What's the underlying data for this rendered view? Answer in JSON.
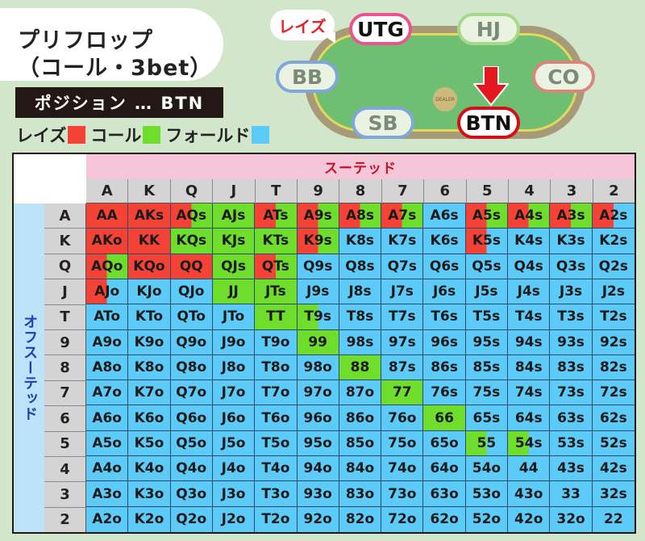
{
  "title": {
    "line1": "プリフロップ",
    "line2": "（コール・3bet）"
  },
  "position_label": "ポジション … BTN",
  "legend": [
    {
      "label": "レイズ",
      "color": "#f44336",
      "action": "raise"
    },
    {
      "label": "コール",
      "color": "#6fdd2c",
      "action": "call"
    },
    {
      "label": "フォールド",
      "color": "#5dcbf8",
      "action": "fold"
    }
  ],
  "table_diagram": {
    "bubble_text": "レイズ",
    "dealer_text": "DEALER",
    "seats": [
      {
        "id": "UTG",
        "label": "UTG",
        "border": "#e9548e",
        "active": true
      },
      {
        "id": "HJ",
        "label": "HJ",
        "border": "#a6d98a",
        "active": false
      },
      {
        "id": "CO",
        "label": "CO",
        "border": "#d9857a",
        "active": false
      },
      {
        "id": "BTN",
        "label": "BTN",
        "border": "#d40f1a",
        "active": true
      },
      {
        "id": "SB",
        "label": "SB",
        "border": "#7ea7dc",
        "active": false
      },
      {
        "id": "BB",
        "label": "BB",
        "border": "#7ea7dc",
        "active": false
      }
    ],
    "hero": "BTN",
    "raiser": "UTG"
  },
  "grid": {
    "suited_header": "スーテッド",
    "offsuit_header": "オフスーテッド",
    "ranks": [
      "A",
      "K",
      "Q",
      "J",
      "T",
      "9",
      "8",
      "7",
      "6",
      "5",
      "4",
      "3",
      "2"
    ],
    "colors": {
      "R": "#f44336",
      "G": "#6fdd2c",
      "B": "#5dcbf8"
    },
    "rows": [
      [
        [
          "AA",
          "R"
        ],
        [
          "AKs",
          "R"
        ],
        [
          "AQs",
          "R/G"
        ],
        [
          "AJs",
          "G"
        ],
        [
          "ATs",
          "R/G"
        ],
        [
          "A9s",
          "R/G"
        ],
        [
          "A8s",
          "R/G"
        ],
        [
          "A7s",
          "R/G"
        ],
        [
          "A6s",
          "B"
        ],
        [
          "A5s",
          "R/G"
        ],
        [
          "A4s",
          "R/G"
        ],
        [
          "A3s",
          "R/G"
        ],
        [
          "A2s",
          "R/B"
        ]
      ],
      [
        [
          "AKo",
          "R"
        ],
        [
          "KK",
          "R"
        ],
        [
          "KQs",
          "G"
        ],
        [
          "KJs",
          "G"
        ],
        [
          "KTs",
          "G"
        ],
        [
          "K9s",
          "R/G"
        ],
        [
          "K8s",
          "B"
        ],
        [
          "K7s",
          "B"
        ],
        [
          "K6s",
          "B"
        ],
        [
          "K5s",
          "R/B"
        ],
        [
          "K4s",
          "B"
        ],
        [
          "K3s",
          "B"
        ],
        [
          "K2s",
          "B"
        ]
      ],
      [
        [
          "AQo",
          "R/G"
        ],
        [
          "KQo",
          "R"
        ],
        [
          "QQ",
          "R"
        ],
        [
          "QJs",
          "G"
        ],
        [
          "QTs",
          "R/G"
        ],
        [
          "Q9s",
          "B"
        ],
        [
          "Q8s",
          "B"
        ],
        [
          "Q7s",
          "B"
        ],
        [
          "Q6s",
          "B"
        ],
        [
          "Q5s",
          "B"
        ],
        [
          "Q4s",
          "B"
        ],
        [
          "Q3s",
          "B"
        ],
        [
          "Q2s",
          "B"
        ]
      ],
      [
        [
          "AJo",
          "R/B"
        ],
        [
          "KJo",
          "B"
        ],
        [
          "QJo",
          "B"
        ],
        [
          "JJ",
          "G"
        ],
        [
          "JTs",
          "G"
        ],
        [
          "J9s",
          "B"
        ],
        [
          "J8s",
          "B"
        ],
        [
          "J7s",
          "B"
        ],
        [
          "J6s",
          "B"
        ],
        [
          "J5s",
          "B"
        ],
        [
          "J4s",
          "B"
        ],
        [
          "J3s",
          "B"
        ],
        [
          "J2s",
          "B"
        ]
      ],
      [
        [
          "ATo",
          "B"
        ],
        [
          "KTo",
          "B"
        ],
        [
          "QTo",
          "B"
        ],
        [
          "JTo",
          "B"
        ],
        [
          "TT",
          "G"
        ],
        [
          "T9s",
          "G/B"
        ],
        [
          "T8s",
          "B"
        ],
        [
          "T7s",
          "B"
        ],
        [
          "T6s",
          "B"
        ],
        [
          "T5s",
          "B"
        ],
        [
          "T4s",
          "B"
        ],
        [
          "T3s",
          "B"
        ],
        [
          "T2s",
          "B"
        ]
      ],
      [
        [
          "A9o",
          "B"
        ],
        [
          "K9o",
          "B"
        ],
        [
          "Q9o",
          "B"
        ],
        [
          "J9o",
          "B"
        ],
        [
          "T9o",
          "B"
        ],
        [
          "99",
          "G"
        ],
        [
          "98s",
          "B"
        ],
        [
          "97s",
          "B"
        ],
        [
          "96s",
          "B"
        ],
        [
          "95s",
          "B"
        ],
        [
          "94s",
          "B"
        ],
        [
          "93s",
          "B"
        ],
        [
          "92s",
          "B"
        ]
      ],
      [
        [
          "A8o",
          "B"
        ],
        [
          "K8o",
          "B"
        ],
        [
          "Q8o",
          "B"
        ],
        [
          "J8o",
          "B"
        ],
        [
          "T8o",
          "B"
        ],
        [
          "98o",
          "B"
        ],
        [
          "88",
          "G"
        ],
        [
          "87s",
          "B"
        ],
        [
          "86s",
          "B"
        ],
        [
          "85s",
          "B"
        ],
        [
          "84s",
          "B"
        ],
        [
          "83s",
          "B"
        ],
        [
          "82s",
          "B"
        ]
      ],
      [
        [
          "A7o",
          "B"
        ],
        [
          "K7o",
          "B"
        ],
        [
          "Q7o",
          "B"
        ],
        [
          "J7o",
          "B"
        ],
        [
          "T7o",
          "B"
        ],
        [
          "97o",
          "B"
        ],
        [
          "87o",
          "B"
        ],
        [
          "77",
          "G"
        ],
        [
          "76s",
          "B"
        ],
        [
          "75s",
          "B"
        ],
        [
          "74s",
          "B"
        ],
        [
          "73s",
          "B"
        ],
        [
          "72s",
          "B"
        ]
      ],
      [
        [
          "A6o",
          "B"
        ],
        [
          "K6o",
          "B"
        ],
        [
          "Q6o",
          "B"
        ],
        [
          "J6o",
          "B"
        ],
        [
          "T6o",
          "B"
        ],
        [
          "96o",
          "B"
        ],
        [
          "86o",
          "B"
        ],
        [
          "76o",
          "B"
        ],
        [
          "66",
          "G"
        ],
        [
          "65s",
          "B"
        ],
        [
          "64s",
          "B"
        ],
        [
          "63s",
          "B"
        ],
        [
          "62s",
          "B"
        ]
      ],
      [
        [
          "A5o",
          "B"
        ],
        [
          "K5o",
          "B"
        ],
        [
          "Q5o",
          "B"
        ],
        [
          "J5o",
          "B"
        ],
        [
          "T5o",
          "B"
        ],
        [
          "95o",
          "B"
        ],
        [
          "85o",
          "B"
        ],
        [
          "75o",
          "B"
        ],
        [
          "65o",
          "B"
        ],
        [
          "55",
          "G/B"
        ],
        [
          "54s",
          "G/B"
        ],
        [
          "53s",
          "B"
        ],
        [
          "52s",
          "B"
        ]
      ],
      [
        [
          "A4o",
          "B"
        ],
        [
          "K4o",
          "B"
        ],
        [
          "Q4o",
          "B"
        ],
        [
          "J4o",
          "B"
        ],
        [
          "T4o",
          "B"
        ],
        [
          "94o",
          "B"
        ],
        [
          "84o",
          "B"
        ],
        [
          "74o",
          "B"
        ],
        [
          "64o",
          "B"
        ],
        [
          "54o",
          "B"
        ],
        [
          "44",
          "B"
        ],
        [
          "43s",
          "B"
        ],
        [
          "42s",
          "B"
        ]
      ],
      [
        [
          "A3o",
          "B"
        ],
        [
          "K3o",
          "B"
        ],
        [
          "Q3o",
          "B"
        ],
        [
          "J3o",
          "B"
        ],
        [
          "T3o",
          "B"
        ],
        [
          "93o",
          "B"
        ],
        [
          "83o",
          "B"
        ],
        [
          "73o",
          "B"
        ],
        [
          "63o",
          "B"
        ],
        [
          "53o",
          "B"
        ],
        [
          "43o",
          "B"
        ],
        [
          "33",
          "B"
        ],
        [
          "32s",
          "B"
        ]
      ],
      [
        [
          "A2o",
          "B"
        ],
        [
          "K2o",
          "B"
        ],
        [
          "Q2o",
          "B"
        ],
        [
          "J2o",
          "B"
        ],
        [
          "T2o",
          "B"
        ],
        [
          "92o",
          "B"
        ],
        [
          "82o",
          "B"
        ],
        [
          "72o",
          "B"
        ],
        [
          "62o",
          "B"
        ],
        [
          "52o",
          "B"
        ],
        [
          "42o",
          "B"
        ],
        [
          "32o",
          "B"
        ],
        [
          "22",
          "B"
        ]
      ]
    ],
    "mixed_split": 0.5
  }
}
